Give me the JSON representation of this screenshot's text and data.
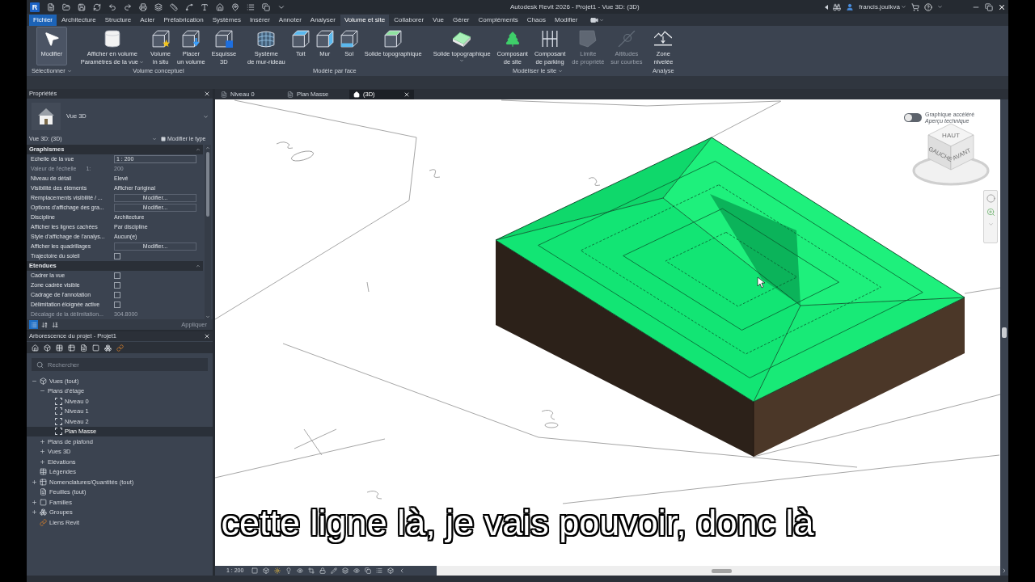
{
  "title_bar": {
    "logo": "R",
    "title": "Autodesk Revit 2026 - Projet1 - Vue 3D: (3D)",
    "user": "francis.joulkva"
  },
  "ribbon_tabs": [
    {
      "label": "Fichier",
      "kind": "file",
      "selected": false
    },
    {
      "label": "Architecture",
      "kind": "tab",
      "selected": false
    },
    {
      "label": "Structure",
      "kind": "tab",
      "selected": false
    },
    {
      "label": "Acier",
      "kind": "tab",
      "selected": false
    },
    {
      "label": "Préfabrication",
      "kind": "tab",
      "selected": false
    },
    {
      "label": "Systèmes",
      "kind": "tab",
      "selected": false
    },
    {
      "label": "Insérer",
      "kind": "tab",
      "selected": false
    },
    {
      "label": "Annoter",
      "kind": "tab",
      "selected": false
    },
    {
      "label": "Analyser",
      "kind": "tab",
      "selected": false
    },
    {
      "label": "Volume et site",
      "kind": "tab",
      "selected": true
    },
    {
      "label": "Collaborer",
      "kind": "tab",
      "selected": false
    },
    {
      "label": "Vue",
      "kind": "tab",
      "selected": false
    },
    {
      "label": "Gérer",
      "kind": "tab",
      "selected": false
    },
    {
      "label": "Compléments",
      "kind": "tab",
      "selected": false
    },
    {
      "label": "Chaos",
      "kind": "tab",
      "selected": false
    },
    {
      "label": "Modifier",
      "kind": "tab",
      "selected": false
    }
  ],
  "ribbon_panels": [
    {
      "label": "Sélectionner",
      "dropdown": true,
      "buttons": [
        {
          "lines": [
            "Modifier"
          ],
          "selected": true,
          "disabled": false
        }
      ]
    },
    {
      "label": "Volume conceptuel",
      "buttons": [
        {
          "lines": [
            "Afficher en volume",
            "Paramètres de la vue"
          ],
          "dropdown": true,
          "selected": false,
          "disabled": false
        },
        {
          "lines": [
            "Volume",
            "in situ"
          ],
          "selected": false,
          "disabled": false
        },
        {
          "lines": [
            "Placer",
            "un volume"
          ],
          "selected": false,
          "disabled": false
        },
        {
          "lines": [
            "Esquisse",
            "3D"
          ],
          "selected": false,
          "disabled": false
        }
      ]
    },
    {
      "label": "Modèle par face",
      "buttons": [
        {
          "lines": [
            "Système",
            "de mur-rideau"
          ],
          "selected": false,
          "disabled": false
        },
        {
          "lines": [
            "Toit"
          ],
          "selected": false,
          "disabled": false
        },
        {
          "lines": [
            "Mur"
          ],
          "selected": false,
          "disabled": false
        },
        {
          "lines": [
            "Sol"
          ],
          "selected": false,
          "disabled": false
        },
        {
          "lines": [
            "Solide topographique"
          ],
          "selected": false,
          "disabled": false
        }
      ]
    },
    {
      "label": "Modéliser le site",
      "dropdown": true,
      "buttons": [
        {
          "lines": [
            "Solide topographique"
          ],
          "dropdown": true,
          "selected": false,
          "disabled": false
        },
        {
          "lines": [
            "Composant",
            "de site"
          ],
          "selected": false,
          "disabled": false
        },
        {
          "lines": [
            "Composant",
            "de parking"
          ],
          "selected": false,
          "disabled": false
        },
        {
          "lines": [
            "Limite",
            "de propriété"
          ],
          "selected": false,
          "disabled": true
        },
        {
          "lines": [
            "Altitudes",
            "sur courbes"
          ],
          "selected": false,
          "disabled": true
        }
      ]
    },
    {
      "label": "Analyse",
      "buttons": [
        {
          "lines": [
            "Zone",
            "nivelée"
          ],
          "selected": false,
          "disabled": false
        }
      ]
    }
  ],
  "properties": {
    "title": "Propriétés",
    "type_name": "Vue 3D",
    "instance": "Vue 3D: (3D)",
    "edit_type": "Modifier le type",
    "groups": [
      {
        "name": "Graphismes",
        "expanded": true,
        "rows": [
          {
            "label": "Echelle de la vue",
            "kind": "input",
            "value": "1 : 200",
            "disabled": false
          },
          {
            "label": "Valeur de l'échelle",
            "prefix": "1:",
            "kind": "text",
            "value": "200",
            "disabled": true
          },
          {
            "label": "Niveau de détail",
            "kind": "text",
            "value": "Elevé",
            "disabled": false
          },
          {
            "label": "Visibilité des éléments",
            "kind": "text",
            "value": "Afficher l'original",
            "disabled": false
          },
          {
            "label": "Remplacements visibilité / ...",
            "kind": "button",
            "value": "Modifier...",
            "disabled": false
          },
          {
            "label": "Options d'affichage des gra...",
            "kind": "button",
            "value": "Modifier...",
            "disabled": false
          },
          {
            "label": "Discipline",
            "kind": "text",
            "value": "Architecture",
            "disabled": false
          },
          {
            "label": "Afficher les lignes cachées",
            "kind": "text",
            "value": "Par discipline",
            "disabled": false
          },
          {
            "label": "Style d'affichage de l'analys...",
            "kind": "text",
            "value": "Aucun(e)",
            "disabled": false
          },
          {
            "label": "Afficher les quadrillages",
            "kind": "button",
            "value": "Modifier...",
            "disabled": false
          },
          {
            "label": "Trajectoire du soleil",
            "kind": "checkbox",
            "checked": false,
            "disabled": false
          }
        ]
      },
      {
        "name": "Etendues",
        "expanded": true,
        "rows": [
          {
            "label": "Cadrer la vue",
            "kind": "checkbox",
            "checked": false,
            "disabled": false
          },
          {
            "label": "Zone cadrée visible",
            "kind": "checkbox",
            "checked": false,
            "disabled": false
          },
          {
            "label": "Cadrage de l'annotation",
            "kind": "checkbox",
            "checked": false,
            "disabled": false
          },
          {
            "label": "Délimitation éloignée active",
            "kind": "checkbox",
            "checked": false,
            "disabled": false
          },
          {
            "label": "Décalage de la délimitation...",
            "kind": "text",
            "value": "304.8000",
            "disabled": true
          }
        ]
      }
    ],
    "view_modes": [
      {
        "selected": true
      },
      {
        "selected": false
      },
      {
        "selected": false
      }
    ],
    "apply_button": {
      "label": "Appliquer",
      "disabled": true
    }
  },
  "project_browser": {
    "title": "Arborescence du projet - Projet1",
    "search": {
      "placeholder": "Rechercher"
    },
    "tree": [
      {
        "label": "Vues (tout)",
        "expanded": true,
        "selected": false,
        "children": [
          {
            "label": "Plans d'étage",
            "expanded": true,
            "selected": false,
            "children": [
              {
                "label": "Niveau 0",
                "selected": false
              },
              {
                "label": "Niveau 1",
                "selected": false
              },
              {
                "label": "Niveau 2",
                "selected": false
              },
              {
                "label": "Plan Masse",
                "selected": true
              }
            ]
          },
          {
            "label": "Plans de plafond",
            "expanded": false,
            "selected": false
          },
          {
            "label": "Vues 3D",
            "expanded": false,
            "selected": false
          },
          {
            "label": "Elévations",
            "expanded": false,
            "selected": false
          }
        ]
      },
      {
        "label": "Légendes",
        "selected": false
      },
      {
        "label": "Nomenclatures/Quantités (tout)",
        "expanded": false,
        "selected": false
      },
      {
        "label": "Feuilles (tout)",
        "selected": false
      },
      {
        "label": "Familles",
        "expanded": false,
        "selected": false
      },
      {
        "label": "Groupes",
        "expanded": false,
        "selected": false
      },
      {
        "label": "Liens Revit",
        "selected": false
      }
    ]
  },
  "view_tabs": [
    {
      "label": "Niveau 0",
      "selected": false
    },
    {
      "label": "Plan Masse",
      "selected": false
    },
    {
      "label": "(3D)",
      "selected": true
    }
  ],
  "viewport": {
    "graphics_toggle": {
      "label": "Graphique accéléré",
      "note": "Aperçu technique",
      "on": false
    },
    "view_cube": {
      "top": "HAUT",
      "left": "GAUCHE",
      "right": "AVANT"
    }
  },
  "view_bar": {
    "scale": "1 : 200"
  },
  "subtitle": "cette ligne là, je vais pouvoir, donc là"
}
